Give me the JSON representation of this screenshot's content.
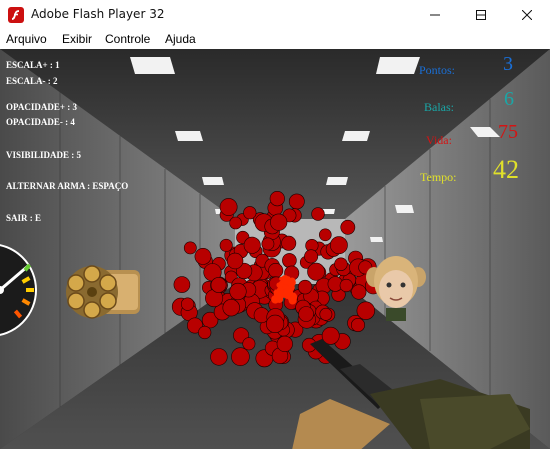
{
  "window": {
    "title": "Adobe Flash Player 32"
  },
  "menu": [
    "Arquivo",
    "Exibir",
    "Controle",
    "Ajuda"
  ],
  "hud": {
    "hints": [
      "ESCALA+ : 1",
      "ESCALA- : 2",
      "OPACIDADE+ : 3",
      "OPACIDADE- : 4",
      "VISIBILIDADE : 5",
      "ALTERNAR ARMA : ESPAÇO",
      "SAIR : E"
    ],
    "stats": {
      "pontos": {
        "label": "Pontos:",
        "value": "3",
        "color": "#1a6fd6"
      },
      "balas": {
        "label": "Balas:",
        "value": "6",
        "color": "#1aa7a7"
      },
      "vida": {
        "label": "Vida:",
        "value": "75",
        "color": "#d41414"
      },
      "tempo": {
        "label": "Tempo:",
        "value": "42",
        "color": "#e0e02a"
      }
    }
  },
  "icons": {
    "app": "flash-player-icon",
    "minimize": "minimize-icon",
    "maximize": "maximize-icon",
    "close": "close-icon",
    "weapon_selector": "revolver-cylinder-icon",
    "gauge": "dial-gauge-icon",
    "target": "girl-target-icon"
  },
  "colors": {
    "bullet_hole": "#b80000",
    "hit_burst": "#ff2a00",
    "corridor": "#6b6b6b"
  }
}
